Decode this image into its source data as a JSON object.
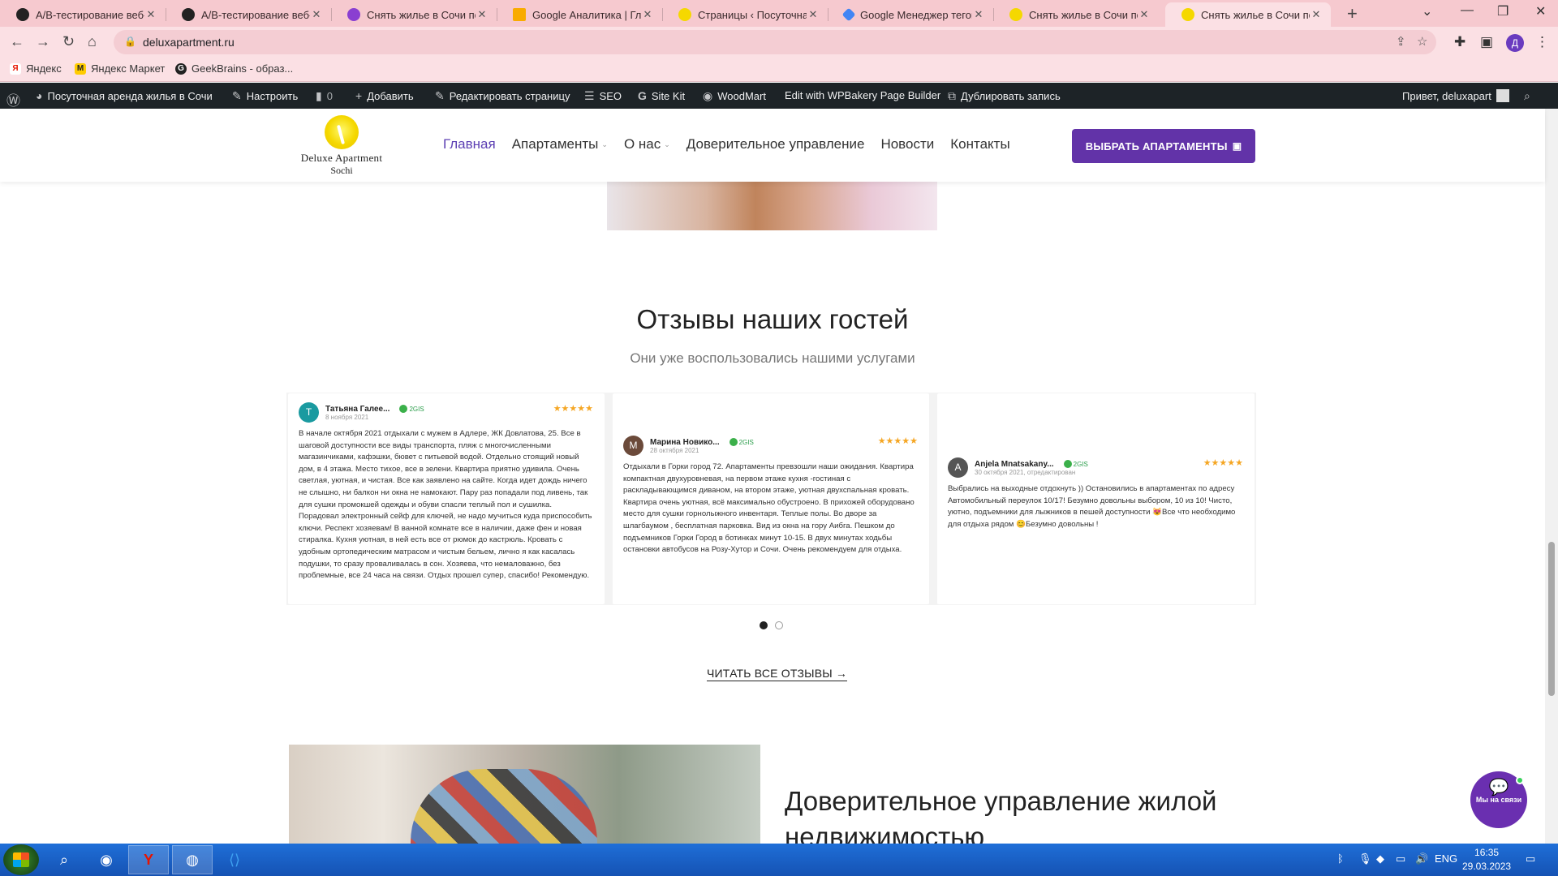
{
  "browser": {
    "tabs": [
      {
        "title": "A/B-тестирование веб-пр",
        "favicon_color": "#222222"
      },
      {
        "title": "A/B-тестирование веб-пр",
        "favicon_color": "#222222"
      },
      {
        "title": "Снять жилье в Сочи посу",
        "favicon_color": "#8a3fd1"
      },
      {
        "title": "Google Аналитика | Главн",
        "favicon_color": "#f9ab00"
      },
      {
        "title": "Страницы ‹ Посуточная а",
        "favicon_color": "#f5d800"
      },
      {
        "title": "Google Менеджер тегов",
        "favicon_color": "#4285f4"
      },
      {
        "title": "Снять жилье в Сочи посу",
        "favicon_color": "#f5d800"
      },
      {
        "title": "Снять жилье в Сочи посу",
        "favicon_color": "#f5d800"
      }
    ],
    "active_tab_index": 7,
    "url": "deluxapartment.ru",
    "profile_initial": "Д",
    "bookmarks": [
      {
        "label": "Яндекс",
        "icon": "yandex-icon"
      },
      {
        "label": "Яндекс Маркет",
        "icon": "market-icon"
      },
      {
        "label": "GeekBrains - образ...",
        "icon": "geekbrains-icon"
      }
    ]
  },
  "wp_admin_bar": {
    "site_name": "Посуточная аренда жилья в Сочи",
    "customize": "Настроить",
    "comments": "0",
    "add_new": "Добавить",
    "edit_page": "Редактировать страницу",
    "seo": "SEO",
    "site_kit": "Site Kit",
    "woodmart": "WoodMart",
    "wpbakery": "Edit with WPBakery Page Builder",
    "duplicate": "Дублировать запись",
    "greeting": "Привет, deluxapart"
  },
  "site": {
    "logo_line1": "Deluxe Apartment",
    "logo_line2": "Sochi",
    "nav": [
      {
        "label": "Главная",
        "active": true
      },
      {
        "label": "Апартаменты",
        "dropdown": true
      },
      {
        "label": "О нас",
        "dropdown": true
      },
      {
        "label": "Доверительное управление"
      },
      {
        "label": "Новости"
      },
      {
        "label": "Контакты"
      }
    ],
    "cta_label": "ВЫБРАТЬ АПАРТАМЕНТЫ",
    "brand_color": "#6233a8"
  },
  "reviews_section": {
    "title": "Отзывы наших гостей",
    "subtitle": "Они уже воспользовались нашими услугами",
    "source_label": "2GIS",
    "stars": "★★★★★",
    "reviews": [
      {
        "author": "Татьяна Галее...",
        "avatar_letter": "T",
        "avatar_color": "#1a9aa0",
        "date": "8 ноября 2021",
        "text": "В начале октября 2021 отдыхали с мужем в Адлере, ЖК Довлатова, 25. Все в шаговой доступности все виды транспорта, пляж с многочисленными магазинчиками, кафэшки, бювет с питьевой водой. Отдельно стоящий новый дом, в 4 этажа. Место тихое, все в зелени. Квартира приятно удивила. Очень светлая, уютная, и чистая. Все как заявлено на сайте. Когда идет дождь ничего не слышно, ни балкон ни окна не намокают. Пару раз попадали под ливень, так для сушки промокшей одежды и обуви спасли теплый пол и сушилка. Порадовал электронный сейф для ключей, не надо мучиться куда приспособить ключи. Респект хозяевам! В ванной комнате все в наличии, даже фен и новая стиралка. Кухня уютная, в ней есть все от рюмок до кастрюль. Кровать с удобным ортопедическим матрасом и чистым бельем, лично я как касалась подушки, то сразу проваливалась в сон. Хозяева, что немаловажно, без проблемные, все 24 часа на связи. Отдых прошел супер, спасибо! Рекомендую."
      },
      {
        "author": "Марина Новико...",
        "avatar_letter": "М",
        "avatar_color": "#6b4a3a",
        "date": "28 октября 2021",
        "text": "Отдыхали в Горки город 72. Апартаменты превзошли наши ожидания. Квартира компактная двухуровневая, на первом этаже кухня -гостиная с раскладывающимся диваном, на втором этаже, уютная двухспальная кровать. Квартира очень уютная, всё максимально обустроено. В прихожей оборудовано место для сушки горнолыжного инвентаря. Теплые полы. Во дворе за шлагбаумом , бесплатная парковка. Вид из окна на гору Аибга. Пешком до подъемников Горки Город в ботинках минут 10-15. В двух минутах ходьбы остановки автобусов на Розу-Хутор и Сочи. Очень рекомендуем для отдыха."
      },
      {
        "author": "Anjela Mnatsakany...",
        "avatar_letter": "A",
        "avatar_color": "#555555",
        "date": "30 октября 2021, отредактирован",
        "text": "Выбрались на выходные отдохнуть )) Остановились в апартаментах по адресу Автомобильный переулок 10/17! Безумно довольны выбором, 10 из 10! Чисто, уютно, подъемники для лыжников в пешей доступности 😻Все что необходимо для отдыха рядом 😊Безумно довольны !"
      }
    ],
    "read_all": "ЧИТАТЬ ВСЕ ОТЗЫВЫ →"
  },
  "trust_section": {
    "title": "Доверительное управление жилой недвижимостью"
  },
  "chat_widget": {
    "label": "Мы на связи"
  },
  "taskbar": {
    "language": "ENG",
    "time": "16:35",
    "date": "29.03.2023"
  }
}
